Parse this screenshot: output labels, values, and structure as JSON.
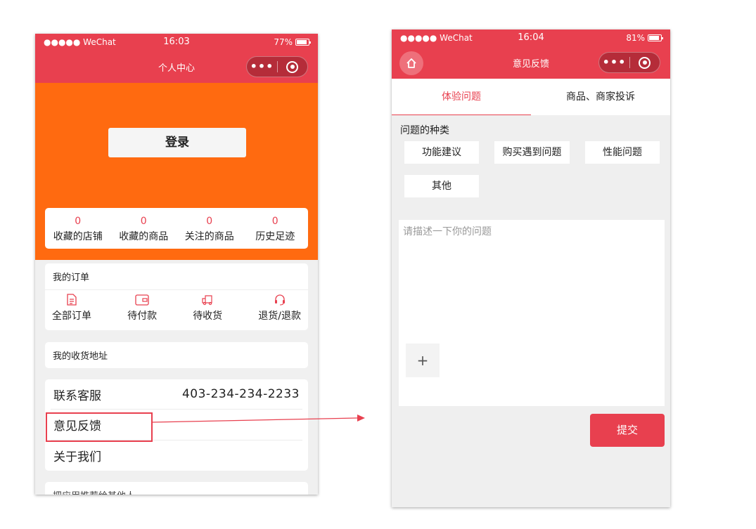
{
  "left_screen": {
    "status": {
      "carrier": "●●●●● WeChat",
      "time": "16:03",
      "battery": "77%"
    },
    "nav_title": "个人中心",
    "capsule_dots": "•••",
    "login_label": "登录",
    "stats": [
      {
        "count": "0",
        "label": "收藏的店铺"
      },
      {
        "count": "0",
        "label": "收藏的商品"
      },
      {
        "count": "0",
        "label": "关注的商品"
      },
      {
        "count": "0",
        "label": "历史足迹"
      }
    ],
    "orders": {
      "title": "我的订单",
      "items": [
        {
          "label": "全部订单",
          "icon": "document-icon"
        },
        {
          "label": "待付款",
          "icon": "wallet-icon"
        },
        {
          "label": "待收货",
          "icon": "truck-icon"
        },
        {
          "label": "退货/退款",
          "icon": "headset-icon"
        }
      ]
    },
    "address_title": "我的收货地址",
    "service": {
      "contact_label": "联系客服",
      "contact_phone": "403-234-234-2233",
      "feedback_label": "意见反馈",
      "about_label": "关于我们"
    },
    "extra_title": "把应用推荐给其他人"
  },
  "right_screen": {
    "status": {
      "carrier": "●●●●● WeChat",
      "time": "16:04",
      "battery": "81%"
    },
    "nav_title": "意见反馈",
    "capsule_dots": "•••",
    "tabs": [
      "体验问题",
      "商品、商家投诉"
    ],
    "question_type_label": "问题的种类",
    "tags": [
      "功能建议",
      "购买遇到问题",
      "性能问题",
      "其他"
    ],
    "description_placeholder": "请描述一下你的问题",
    "add_image_label": "+",
    "submit_label": "提交"
  },
  "colors": {
    "accent": "#e8404f",
    "hero": "#ff6a10"
  }
}
